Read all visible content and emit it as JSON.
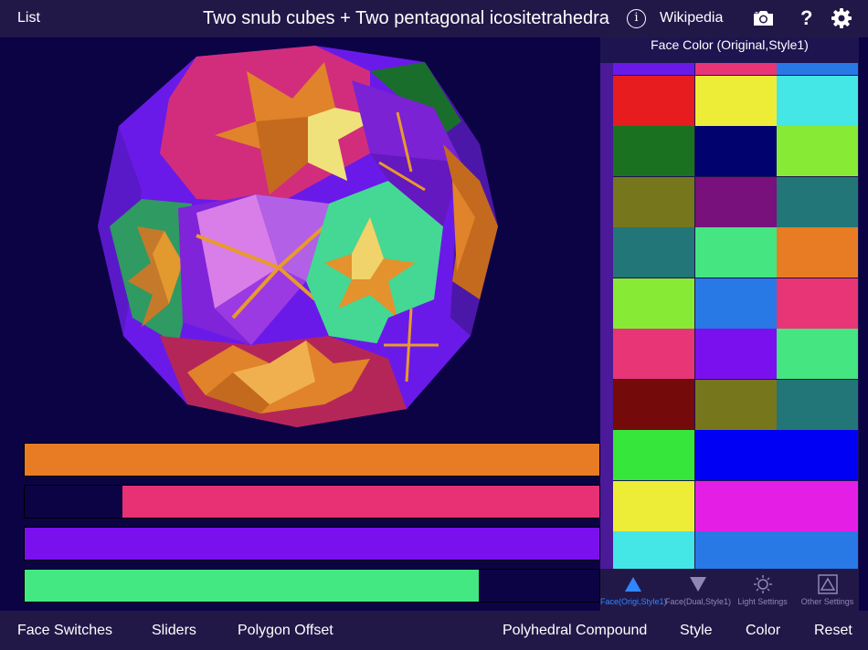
{
  "topbar": {
    "list_label": "List",
    "title": "Two snub cubes + Two pentagonal icositetrahedra",
    "info_glyph": "i",
    "wikipedia_label": "Wikipedia",
    "help_glyph": "?",
    "icons": [
      "info-icon",
      "camera-icon",
      "help-icon",
      "gear-icon"
    ]
  },
  "bars": [
    {
      "name": "orange-bar",
      "color": "#e87c24",
      "level_pct": 100
    },
    {
      "name": "pink-bar",
      "color": "#e83074",
      "level_pct": 83
    },
    {
      "name": "purple-bar",
      "color": "#7b10ee",
      "level_pct": 100
    },
    {
      "name": "green-bar",
      "color": "#44e882",
      "level_pct": 79
    }
  ],
  "panel": {
    "title": "Face Color (Original,Style1)",
    "swatches": [
      [
        "#6a1ae8",
        "#e83576",
        "#2878e6"
      ],
      [
        "#e61c1f",
        "#eded38",
        "#45e6e6"
      ],
      [
        "#1a7220",
        "#02026e",
        "#87ea35"
      ],
      [
        "#76761d",
        "#78117c",
        "#227678"
      ],
      [
        "#227678",
        "#45e581",
        "#e87c24"
      ],
      [
        "#87ea35",
        "#2878e6",
        "#e83576"
      ],
      [
        "#e83576",
        "#7b10ee",
        "#45e581"
      ],
      [
        "#750a0a",
        "#76761d",
        "#227678"
      ],
      [
        "#36e63a",
        "#0000f4",
        "#0000f4"
      ],
      [
        "#eded38",
        "#e51ee5",
        "#e51ee5"
      ],
      [
        "#45e6e6",
        "#2878e6",
        "#2878e6"
      ]
    ],
    "tabs": [
      {
        "label": "Face(Origi,Style1)",
        "icon": "triangle-up-icon",
        "active": true
      },
      {
        "label": "Face(Dual,Style1)",
        "icon": "triangle-down-icon",
        "active": false
      },
      {
        "label": "Light Settings",
        "icon": "sun-icon",
        "active": false
      },
      {
        "label": "Other Settings",
        "icon": "triangle-box-icon",
        "active": false
      }
    ],
    "accent_color": "#2f86ff"
  },
  "bottombar": {
    "face_switches": "Face Switches",
    "sliders": "Sliders",
    "polygon_offset": "Polygon Offset",
    "polyhedral_compound": "Polyhedral Compound",
    "style": "Style",
    "color": "Color",
    "reset": "Reset"
  }
}
